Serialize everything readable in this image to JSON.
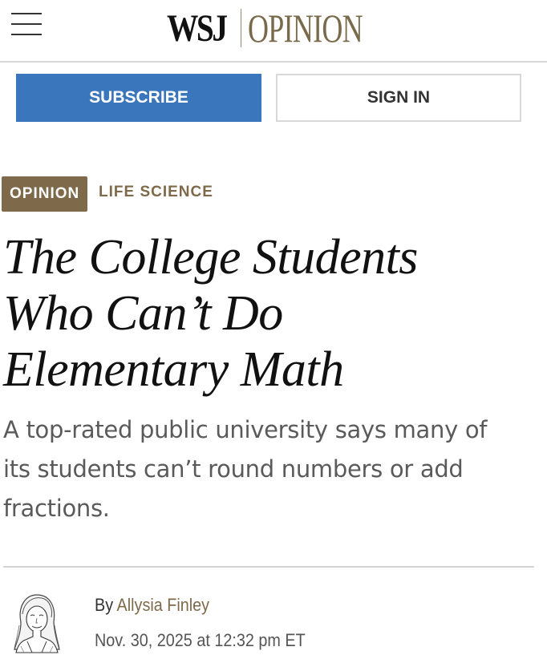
{
  "header": {
    "logo_wsj": "WSJ",
    "logo_section": "OPINION",
    "menu_icon": "hamburger-menu-icon"
  },
  "actions": {
    "subscribe_label": "SUBSCRIBE",
    "signin_label": "SIGN IN"
  },
  "article": {
    "tag": "OPINION",
    "section": "LIFE SCIENCE",
    "headline_lines": [
      "The College Students",
      "Who Can’t Do",
      "Elementary Math"
    ],
    "dek_lines": [
      "A top-rated public university says many of",
      "its students can’t round numbers or add",
      "fractions."
    ],
    "byline_prefix": "By",
    "author": "Allysia Finley",
    "date": "Nov. 30, 2025 at 12:32 pm ET"
  },
  "colors": {
    "brand_gold": "#7e6a4a",
    "subscribe_blue": "#3a76bb"
  }
}
